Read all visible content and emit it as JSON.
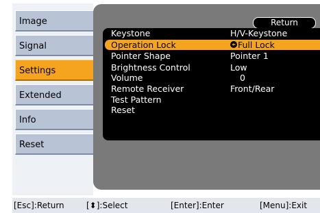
{
  "tabs": [
    {
      "label": "Image",
      "active": false
    },
    {
      "label": "Signal",
      "active": false
    },
    {
      "label": "Settings",
      "active": true
    },
    {
      "label": "Extended",
      "active": false
    },
    {
      "label": "Info",
      "active": false
    },
    {
      "label": "Reset",
      "active": false
    }
  ],
  "panel": {
    "return_label": "Return",
    "rows": [
      {
        "label": "Keystone",
        "value": "H/V-Keystone",
        "selected": false
      },
      {
        "label": "Operation Lock",
        "value": "Full Lock",
        "selected": true
      },
      {
        "label": "Pointer Shape",
        "value": "Pointer 1",
        "selected": false
      },
      {
        "label": "Brightness Control",
        "value": "Low",
        "selected": false
      },
      {
        "label": "Volume",
        "value": "0",
        "selected": false
      },
      {
        "label": "Remote Receiver",
        "value": "Front/Rear",
        "selected": false
      },
      {
        "label": "Test Pattern",
        "value": "",
        "selected": false
      },
      {
        "label": "Reset",
        "value": "",
        "selected": false
      }
    ]
  },
  "helpbar": {
    "esc": "[Esc]:Return",
    "select": "[⬍]:Select",
    "enter": "[Enter]:Enter",
    "menu": "[Menu]:Exit"
  },
  "colors": {
    "accent": "#f4a41e",
    "tab": "#b9c3d6",
    "panel": "#7a7a7a",
    "content": "#000000"
  },
  "icons": {
    "enter_mark": "enter-arrow-icon"
  }
}
